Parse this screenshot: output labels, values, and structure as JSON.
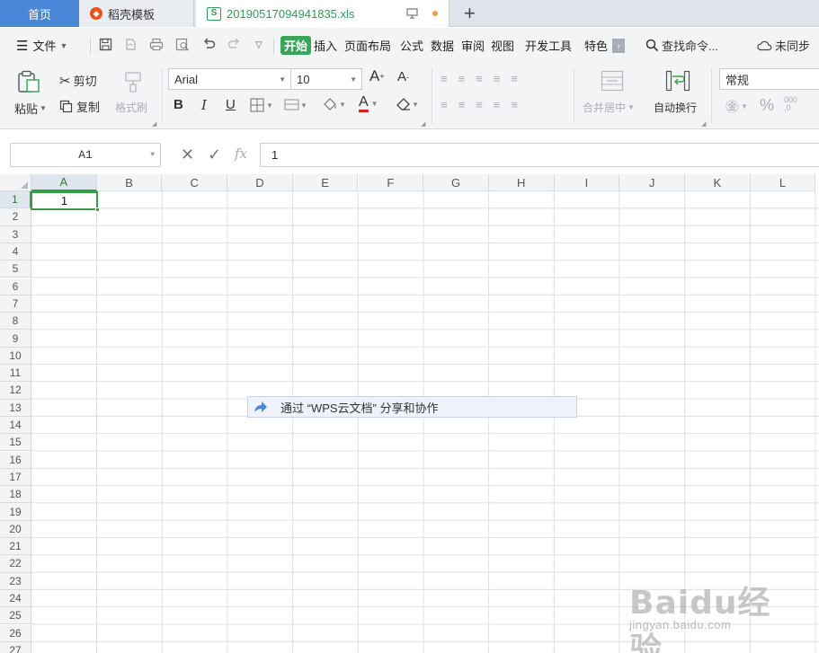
{
  "tabs": {
    "home": "首页",
    "daoke": "稻壳模板",
    "file": "20190517094941835.xls",
    "add": "+"
  },
  "menu": {
    "file": "文件",
    "start": "开始",
    "insert": "插入",
    "page_layout": "页面布局",
    "formula": "公式",
    "data": "数据",
    "review": "审阅",
    "view": "视图",
    "dev_tools": "开发工具",
    "special": "特色",
    "search": "查找命令...",
    "sync": "未同步"
  },
  "ribbon": {
    "paste": "粘贴",
    "cut": "剪切",
    "copy": "复制",
    "format_painter": "格式刷",
    "font_name": "Arial",
    "font_size": "10",
    "bold": "B",
    "italic": "I",
    "underline": "U",
    "merge_center": "合并居中",
    "wrap_text": "自动换行",
    "number_format": "常规"
  },
  "formula_bar": {
    "name_box": "A1",
    "fx": "fx",
    "value": "1"
  },
  "grid": {
    "columns": [
      "A",
      "B",
      "C",
      "D",
      "E",
      "F",
      "G",
      "H",
      "I",
      "J",
      "K",
      "L"
    ],
    "rows": [
      "1",
      "2",
      "3",
      "4",
      "5",
      "6",
      "7",
      "8",
      "9",
      "10",
      "11",
      "12",
      "13",
      "14",
      "15",
      "16",
      "17",
      "18",
      "19",
      "20",
      "21",
      "22",
      "23",
      "24",
      "25",
      "26",
      "27"
    ],
    "active_cell_value": "1"
  },
  "share_tip": "通过 “WPS云文档” 分享和协作",
  "watermark": {
    "logo": "Baidu经验",
    "url": "jingyan.baidu.com"
  },
  "colors": {
    "accent_green": "#3a9b4e",
    "tab_blue": "#4a87d8"
  }
}
